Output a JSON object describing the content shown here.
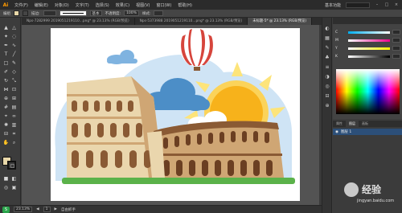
{
  "app": {
    "logo": "Ai"
  },
  "menubar": {
    "items": [
      "文件(F)",
      "编辑(E)",
      "对象(O)",
      "文字(T)",
      "选择(S)",
      "效果(C)",
      "视图(V)",
      "窗口(W)",
      "帮助(H)"
    ],
    "workspace": "基本功能"
  },
  "controlbar": {
    "selection": "编组",
    "stroke_label": "描边:",
    "stroke_style": "基本",
    "opacity_label": "不透明度:",
    "opacity_value": "100%",
    "style_label": "样式:"
  },
  "tabs": [
    {
      "label": "Nps-7282999 2019051219110...png* @ 23.13% (RGB/预览)",
      "active": false
    },
    {
      "label": "Nps-5373988 2019051219110...png* @ 23.13% (RGB/预览)",
      "active": false
    },
    {
      "label": "未标题-5* @ 23.13% (RGB/预览)",
      "active": true
    }
  ],
  "statusbar": {
    "ime": "S",
    "zoom": "23.13%",
    "artboard_nav": "1",
    "tool_name": "自由抓手"
  },
  "color_panel": {
    "sliders": [
      {
        "label": "C",
        "gradient": [
          "#00aeef",
          "#ffffff"
        ]
      },
      {
        "label": "M",
        "gradient": [
          "#ffffff",
          "#ec008c"
        ]
      },
      {
        "label": "Y",
        "gradient": [
          "#ffffff",
          "#fff200"
        ]
      },
      {
        "label": "K",
        "gradient": [
          "#ffffff",
          "#000000"
        ]
      }
    ]
  },
  "layers_panel": {
    "tabs": [
      "属性",
      "图层",
      "画板"
    ],
    "layer_name": "图层 1"
  },
  "watermark": {
    "text": "经验",
    "url": "jingyan.baidu.com"
  },
  "colors": {
    "fill": "#e8d7a9",
    "sky": "#cfe4f5",
    "grass": "#5bb24a",
    "sun": "#f7b21b",
    "sun_rays": "#fde47a",
    "cloud_dark": "#4c8ec7",
    "cloud_mid": "#7fb3e0",
    "balloon_red": "#d6453c",
    "colosseum_light": "#ead6ad",
    "colosseum_mid": "#cfa674",
    "colosseum_dark": "#8a5a34",
    "arch_shadow": "#6b3f22"
  }
}
